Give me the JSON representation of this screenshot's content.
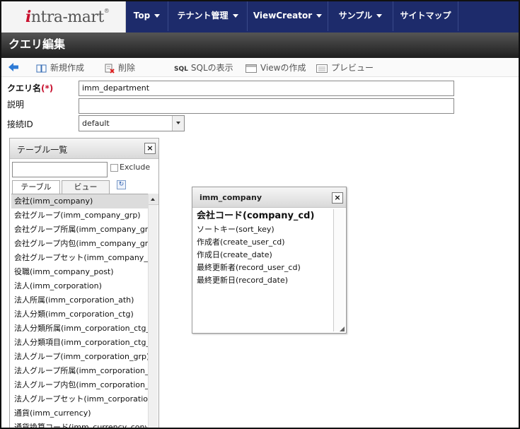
{
  "nav": {
    "logo_i": "i",
    "logo_rest": "ntra-mart",
    "logo_reg": "®",
    "items": [
      "Top",
      "テナント管理",
      "ViewCreator",
      "サンプル",
      "サイトマップ"
    ]
  },
  "page": {
    "title": "クエリ編集"
  },
  "toolbar": {
    "new": "新規作成",
    "delete": "削除",
    "sql_badge": "SQL",
    "show_sql": "SQLの表示",
    "create_view": "Viewの作成",
    "preview": "プレビュー"
  },
  "form": {
    "query_name_label": "クエリ名",
    "required_mark": "(*)",
    "query_name_value": "imm_department",
    "description_label": "説明",
    "description_value": "",
    "connection_label": "接続ID",
    "connection_value": "default"
  },
  "table_panel": {
    "title": "テーブル一覧",
    "close": "×",
    "filter_value": "",
    "exclude_label": "Exclude",
    "tab_table": "テーブル",
    "tab_view": "ビュー",
    "items": [
      "会社(imm_company)",
      "会社グループ(imm_company_grp)",
      "会社グループ所属(imm_company_grp_ath)",
      "会社グループ内包(imm_company_grp_incl)",
      "会社グループセット(imm_company_grp_set)",
      "役職(imm_company_post)",
      "法人(imm_corporation)",
      "法人所属(imm_corporation_ath)",
      "法人分類(imm_corporation_ctg)",
      "法人分類所属(imm_corporation_ctg_ath)",
      "法人分類項目(imm_corporation_ctg_itm)",
      "法人グループ(imm_corporation_grp)",
      "法人グループ所属(imm_corporation_grp_ath)",
      "法人グループ内包(imm_corporation_grp_incl)",
      "法人グループセット(imm_corporation_grp_set)",
      "通貨(imm_currency)",
      "通貨換算コード(imm_currency_conversion)"
    ]
  },
  "table_window": {
    "title": "imm_company",
    "close": "×",
    "columns": [
      "会社コード(company_cd)",
      "ソートキー(sort_key)",
      "作成者(create_user_cd)",
      "作成日(create_date)",
      "最終更新者(record_user_cd)",
      "最終更新日(record_date)"
    ]
  }
}
